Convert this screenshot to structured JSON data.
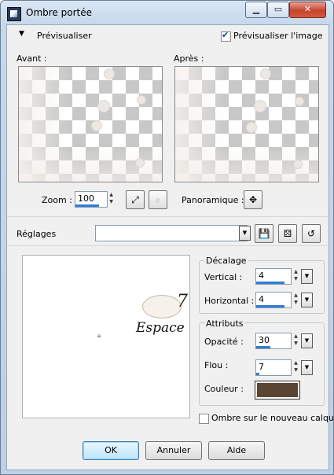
{
  "window": {
    "title": "Ombre portée",
    "min_label": "▁",
    "max_label": "▭",
    "close_label": "✕"
  },
  "preview_section": {
    "toggle_arrow": "▼",
    "toggle_label": "Prévisualiser",
    "preview_image_label": "Prévisualiser l'image",
    "preview_image_checked": true,
    "before_label": "Avant :",
    "after_label": "Après :"
  },
  "zoom": {
    "label": "Zoom :",
    "value": "100"
  },
  "pan": {
    "label": "Panoramique :",
    "icon": "✥"
  },
  "presets": {
    "label": "Réglages",
    "value": ""
  },
  "offset": {
    "group_label": "Décalage",
    "vertical_label": "Vertical :",
    "vertical_value": "4",
    "horizontal_label": "Horizontal :",
    "horizontal_value": "4"
  },
  "attributes": {
    "group_label": "Attributs",
    "opacity_label": "Opacité :",
    "opacity_value": "30",
    "blur_label": "Flou :",
    "blur_value": "7",
    "color_label": "Couleur :",
    "color_hex": "#5a4533"
  },
  "new_layer": {
    "label": "Ombre sur le nouveau calque",
    "checked": false
  },
  "buttons": {
    "ok": "OK",
    "cancel": "Annuler",
    "help": "Aide"
  },
  "stamp": {
    "text": "Espace",
    "number": "7"
  }
}
